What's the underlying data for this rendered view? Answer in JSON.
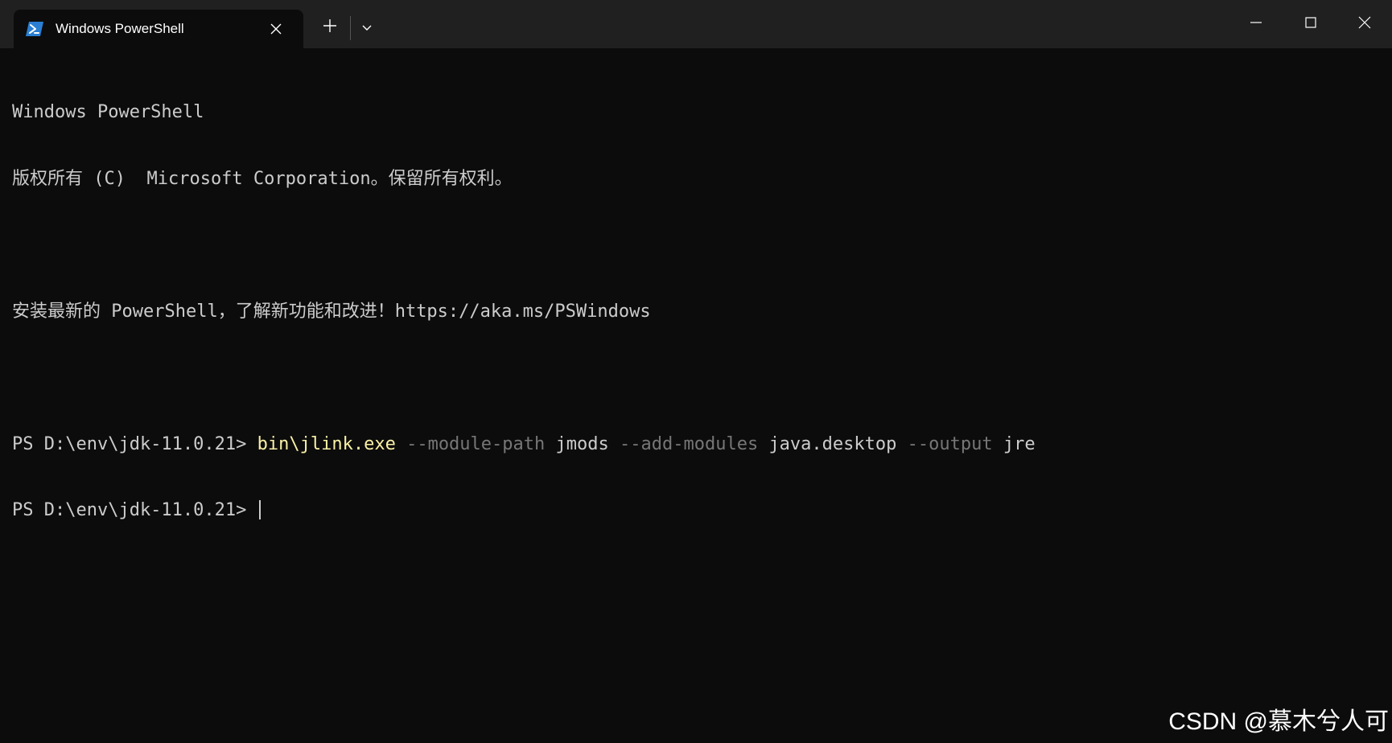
{
  "window": {
    "tab_title": "Windows PowerShell",
    "colors": {
      "titlebar": "#202020",
      "background": "#0c0c0c",
      "text": "#cccccc",
      "exe": "#f9f1a5",
      "param": "#767676",
      "ps_icon": "#2a7fd4"
    }
  },
  "terminal": {
    "banner_line1": "Windows PowerShell",
    "banner_line2": "版权所有 (C)  Microsoft Corporation。保留所有权利。",
    "install_hint": "安装最新的 PowerShell，了解新功能和改进！https://aka.ms/PSWindows",
    "prompt1": "PS D:\\env\\jdk-11.0.21> ",
    "command": {
      "exe": "bin\\jlink.exe",
      "param1": "--module-path",
      "arg1": "jmods",
      "param2": "--add-modules",
      "arg2": "java.desktop",
      "param3": "--output",
      "arg3": "jre"
    },
    "prompt2": "PS D:\\env\\jdk-11.0.21> "
  },
  "watermark": "CSDN @慕木兮人可"
}
